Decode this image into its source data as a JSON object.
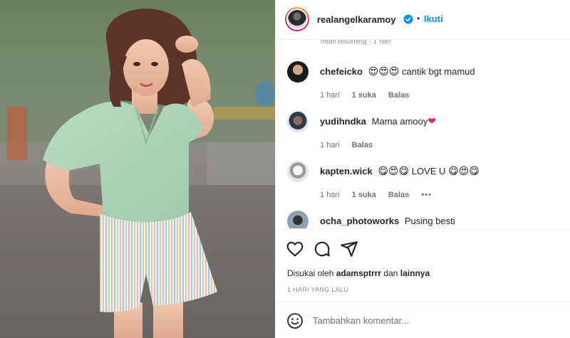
{
  "post": {
    "username": "realangelkaramoy",
    "follow_label": "Ikuti",
    "separator": "•",
    "edited_label": "Telah disunting · 1 hari"
  },
  "comments": [
    {
      "user": "chefeicko",
      "emoji_before": "😍😍😍",
      "text": "cantik bgt mamud",
      "emoji_after": "",
      "time": "1 hari",
      "likes": "1 suka",
      "reply": "Balas",
      "more": ""
    },
    {
      "user": "yudihndka",
      "emoji_before": "",
      "text": "Mama amooy",
      "emoji_after": "❤",
      "time": "1 hari",
      "likes": "",
      "reply": "Balas",
      "more": ""
    },
    {
      "user": "kapten.wick",
      "emoji_before": "😋😍😋",
      "text": "LOVE U",
      "emoji_after": "😋😍😋",
      "time": "1 hari",
      "likes": "1 suka",
      "reply": "Balas",
      "more": "•••"
    },
    {
      "user": "ocha_photoworks",
      "emoji_before": "",
      "text": "Pusing besti",
      "emoji_after": "",
      "time": "",
      "likes": "",
      "reply": "",
      "more": ""
    }
  ],
  "footer": {
    "liked_prefix": "Disukai oleh",
    "liked_user": "adamsptrrr",
    "liked_and": "dan",
    "liked_others": "lainnya",
    "time_ago": "1 HARI YANG LALU",
    "comment_placeholder": "Tambahkan komentar..."
  },
  "icons": {
    "like": "heart-icon",
    "comment": "comment-icon",
    "share": "share-icon",
    "emoji": "smile-icon",
    "verified": "verified-badge-icon"
  },
  "colors": {
    "accent": "#0095f6",
    "heart": "#e0245e"
  }
}
